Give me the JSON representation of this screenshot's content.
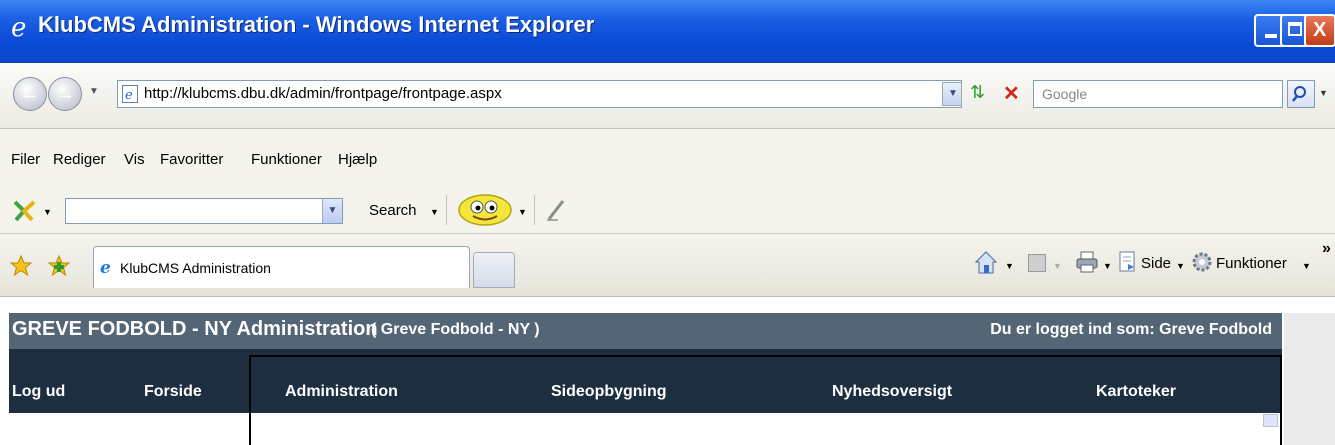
{
  "window": {
    "title": "KlubCMS Administration - Windows Internet Explorer",
    "minimize_label": "_",
    "maximize_label": "□",
    "close_label": "X"
  },
  "addressbar": {
    "url": "http://klubcms.dbu.dk/admin/frontpage/frontpage.aspx",
    "search_placeholder": "Google"
  },
  "menu": [
    "Filer",
    "Rediger",
    "Vis",
    "Favoritter",
    "Funktioner",
    "Hjælp"
  ],
  "toolbar": {
    "search_label": "Search"
  },
  "tabs": {
    "active_tab": "KlubCMS Administration",
    "commands": {
      "page": "Side",
      "tools": "Funktioner",
      "more": "»"
    }
  },
  "site": {
    "title": "GREVE FODBOLD - NY Administration",
    "subtitle": "( Greve Fodbold - NY )",
    "logged_in": "Du er logget ind som: Greve Fodbold",
    "nav": [
      "Log ud",
      "Forside",
      "Administration",
      "Sideopbygning",
      "Nyhedsoversigt",
      "Kartoteker"
    ]
  },
  "colors": {
    "titlebar": "#0a4ad6",
    "site_header": "#546675",
    "site_nav": "#1c2e3f"
  }
}
